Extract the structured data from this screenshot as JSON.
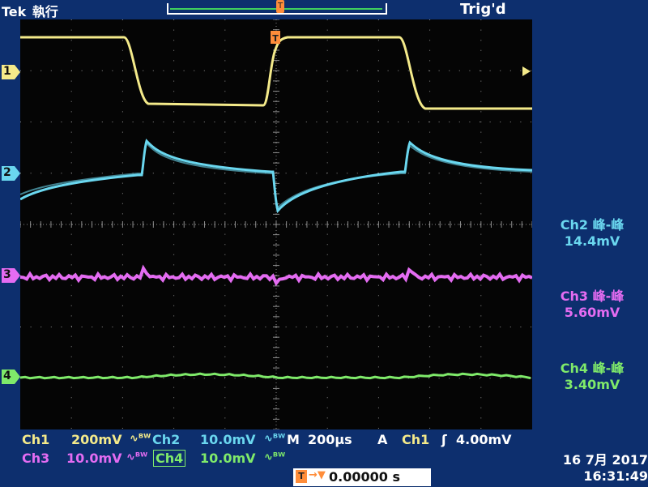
{
  "top_bar": {
    "brand": "Tek",
    "mode": "執行",
    "trigger_status": "Trig'd"
  },
  "channels": [
    {
      "id": "1",
      "color": "#f4ea8a"
    },
    {
      "id": "2",
      "color": "#6ad7ef"
    },
    {
      "id": "3",
      "color": "#e46cf2"
    },
    {
      "id": "4",
      "color": "#7fea6a"
    }
  ],
  "measurements": [
    {
      "title": "Ch2 峰-峰",
      "value": "14.4mV",
      "color": "#6ad7ef"
    },
    {
      "title": "Ch3 峰-峰",
      "value": "5.60mV",
      "color": "#e46cf2"
    },
    {
      "title": "Ch4 峰-峰",
      "value": "3.40mV",
      "color": "#7fea6a"
    }
  ],
  "status": {
    "ch1_label": "Ch1",
    "ch1_scale": "200mV",
    "ch2_label": "Ch2",
    "ch2_scale": "10.0mV",
    "ch3_label": "Ch3",
    "ch3_scale": "10.0mV",
    "ch4_label": "Ch4",
    "ch4_scale": "10.0mV",
    "timebase_label": "M",
    "timebase": "200µs",
    "acq_label": "A",
    "trig_source": "Ch1",
    "trig_level": "4.00mV",
    "trig_position": "0.00000 s",
    "date": "16 7月  2017",
    "time": "16:31:49"
  }
}
